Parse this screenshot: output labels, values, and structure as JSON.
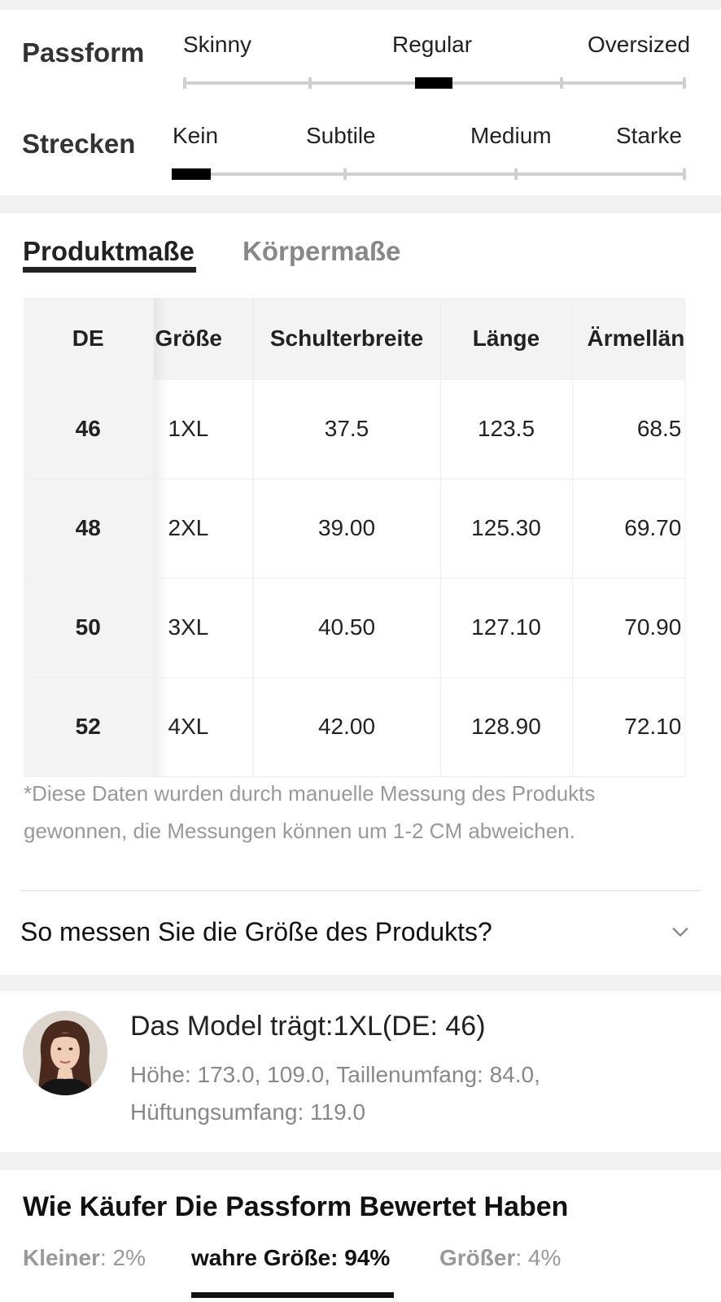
{
  "fit": {
    "passform": {
      "title": "Passform",
      "labels": [
        "Skinny",
        "Regular",
        "Oversized"
      ],
      "selected": "Regular"
    },
    "strecken": {
      "title": "Strecken",
      "labels": [
        "Kein",
        "Subtile",
        "Medium",
        "Starke"
      ],
      "selected": "Kein"
    }
  },
  "measurements": {
    "tabs": [
      {
        "label": "Produktmaße",
        "active": true
      },
      {
        "label": "Körpermaße",
        "active": false
      }
    ],
    "table": {
      "headers": [
        "DE",
        "Größe",
        "Schulterbreite",
        "Länge",
        "Ärmellän"
      ],
      "rows": [
        [
          "46",
          "1XL",
          "37.5",
          "123.5",
          "68.5"
        ],
        [
          "48",
          "2XL",
          "39.00",
          "125.30",
          "69.70"
        ],
        [
          "50",
          "3XL",
          "40.50",
          "127.10",
          "70.90"
        ],
        [
          "52",
          "4XL",
          "42.00",
          "128.90",
          "72.10"
        ]
      ]
    },
    "note": "*Diese Daten wurden durch manuelle Messung des Produkts gewonnen, die Messungen können um 1-2 CM abweichen.",
    "howto": "So messen Sie die Größe des Produkts?"
  },
  "model": {
    "title": "Das Model trägt:1XL(DE: 46)",
    "details": "Höhe: 173.0,   109.0,  Taillenumfang: 84.0, Hüftungsumfang: 119.0"
  },
  "buyer_fit": {
    "title": "Wie Käufer Die Passform Bewertet Haben",
    "items": [
      {
        "label": "Kleiner",
        "value": ": 2%",
        "active": false
      },
      {
        "label": "wahre Größe",
        "value": ": 94%",
        "active": true
      },
      {
        "label": "Größer",
        "value": ": 4%",
        "active": false
      }
    ]
  },
  "icons": {
    "howto_toggle": "chevron-down-icon",
    "model_avatar": "avatar"
  }
}
